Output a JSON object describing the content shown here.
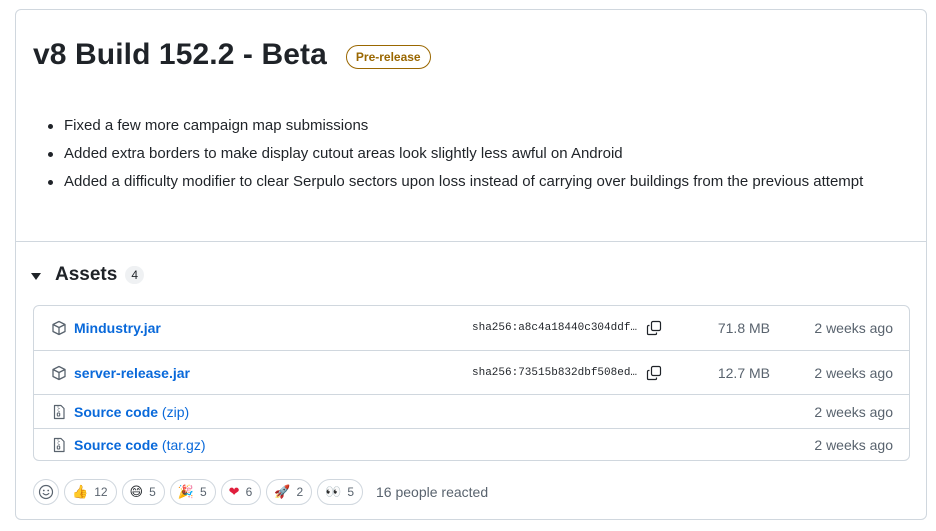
{
  "release": {
    "title": "v8 Build 152.2 - Beta",
    "badge": "Pre-release",
    "notes": [
      "Fixed a few more campaign map submissions",
      "Added extra borders to make display cutout areas look slightly less awful on Android",
      "Added a difficulty modifier to clear Serpulo sectors upon loss instead of carrying over buildings from the previous attempt"
    ]
  },
  "assets": {
    "title": "Assets",
    "count": "4",
    "items": [
      {
        "name": "Mindustry.jar",
        "ext": "",
        "sha": "sha256:a8c4a18440c304ddf…",
        "size": "71.8 MB",
        "date": "2 weeks ago",
        "icon": "package-icon"
      },
      {
        "name": "server-release.jar",
        "ext": "",
        "sha": "sha256:73515b832dbf508ed…",
        "size": "12.7 MB",
        "date": "2 weeks ago",
        "icon": "package-icon"
      },
      {
        "name": "Source code",
        "ext": "(zip)",
        "sha": "",
        "size": "",
        "date": "2 weeks ago",
        "icon": "file-zip-icon"
      },
      {
        "name": "Source code",
        "ext": "(tar.gz)",
        "sha": "",
        "size": "",
        "date": "2 weeks ago",
        "icon": "file-zip-icon"
      }
    ]
  },
  "reactions": {
    "items": [
      {
        "emoji": "👍",
        "name": "thumbs-up",
        "count": "12"
      },
      {
        "emoji": "😄",
        "name": "laugh",
        "count": "5"
      },
      {
        "emoji": "🎉",
        "name": "hooray",
        "count": "5"
      },
      {
        "emoji": "❤",
        "name": "heart",
        "count": "6"
      },
      {
        "emoji": "🚀",
        "name": "rocket",
        "count": "2"
      },
      {
        "emoji": "👀",
        "name": "eyes",
        "count": "5"
      }
    ],
    "summary": "16 people reacted"
  },
  "colors": {
    "link": "#0969da",
    "badge": "#9a6700",
    "border": "#d0d7de",
    "muted": "#59636e"
  }
}
